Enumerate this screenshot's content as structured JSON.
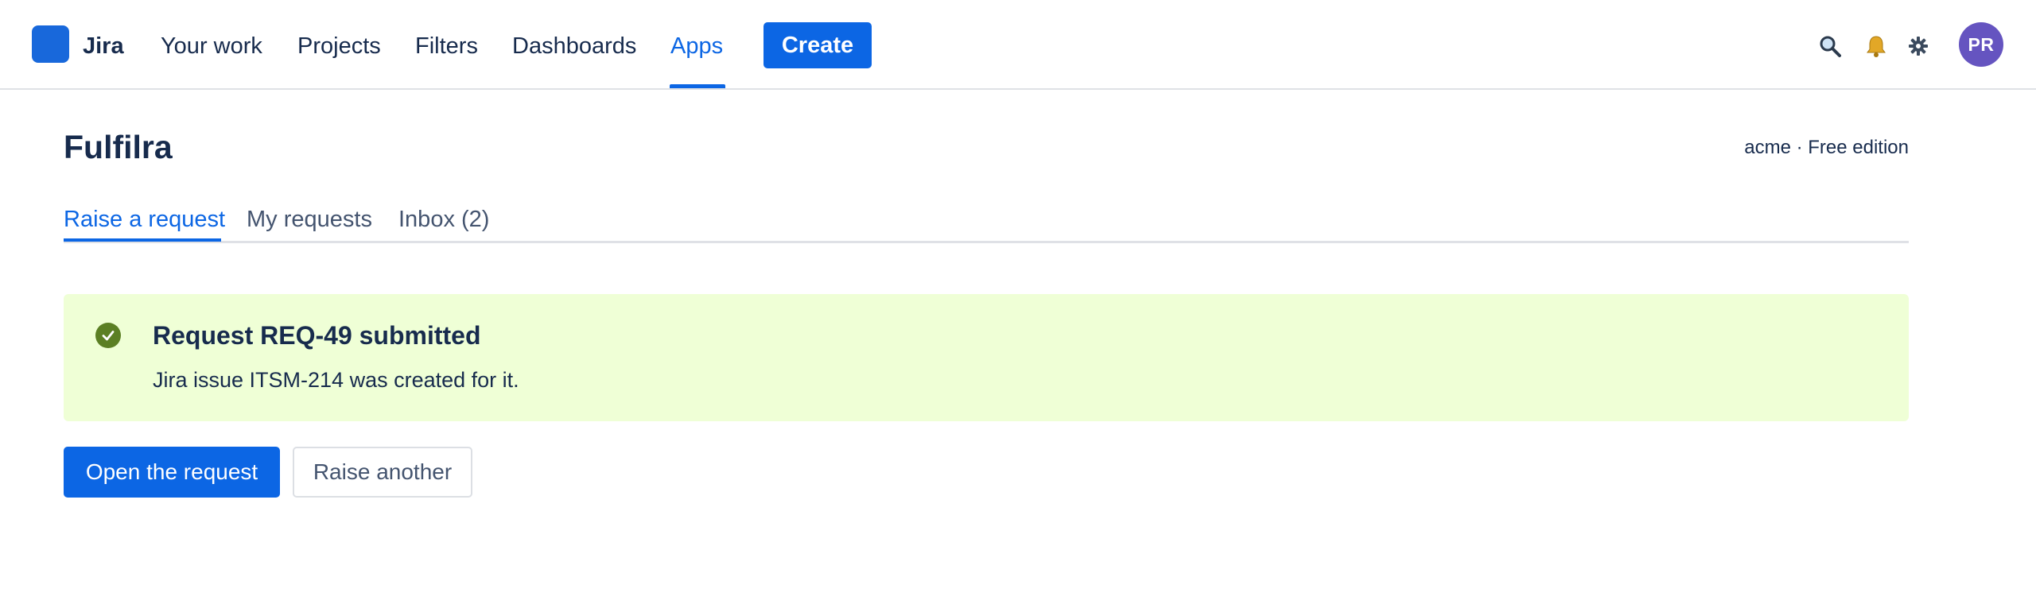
{
  "topnav": {
    "brand": "Jira",
    "items": [
      {
        "label": "Your work"
      },
      {
        "label": "Projects"
      },
      {
        "label": "Filters"
      },
      {
        "label": "Dashboards"
      },
      {
        "label": "Apps",
        "active": true
      }
    ],
    "create_label": "Create",
    "icons": [
      "search-icon",
      "bell-icon",
      "gear-icon"
    ],
    "avatar_initials": "PR",
    "colors": {
      "accent": "#0c66e4",
      "avatar": "#6554c0",
      "logo": "#1868db"
    }
  },
  "page": {
    "title": "Fulfilra",
    "edition": "acme · Free edition"
  },
  "tabs": [
    {
      "label": "Raise a request",
      "active": true
    },
    {
      "label": "My requests"
    },
    {
      "label": "Inbox (2)"
    }
  ],
  "banner": {
    "status": "success",
    "icon": "check-circle-icon",
    "title": "Request REQ-49 submitted",
    "body": "Jira issue ITSM-214 was created for it.",
    "colors": {
      "background": "#efffd6",
      "icon": "#5b7f24"
    }
  },
  "actions": {
    "primary_label": "Open the request",
    "secondary_label": "Raise another"
  }
}
